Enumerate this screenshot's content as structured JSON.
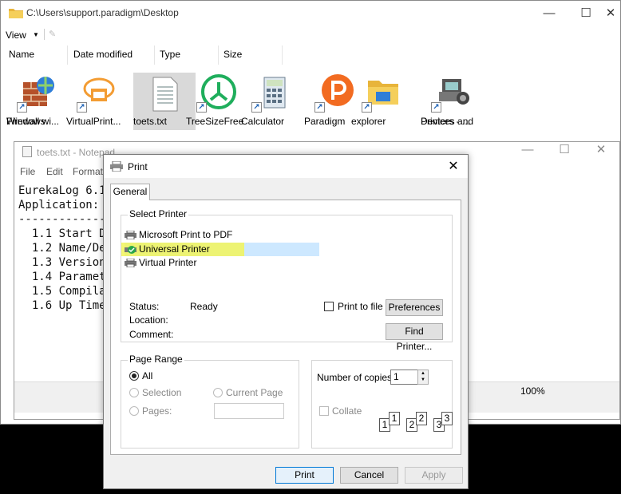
{
  "explorer": {
    "title": "C:\\Users\\support.paradigm\\Desktop",
    "toolbar": {
      "view_label": "View"
    },
    "columns": [
      "Name",
      "Date modified",
      "Type",
      "Size"
    ],
    "items": [
      {
        "label1": "Windows",
        "label2": "Firewall wi...",
        "icon": "firewall-icon"
      },
      {
        "label1": "VirtualPrint...",
        "label2": "",
        "icon": "virtualprinter-icon"
      },
      {
        "label1": "toets.txt",
        "label2": "",
        "icon": "text-file-icon"
      },
      {
        "label1": "TreeSizeFree",
        "label2": "",
        "icon": "treesize-icon"
      },
      {
        "label1": "Calculator",
        "label2": "",
        "icon": "calculator-icon"
      },
      {
        "label1": "Paradigm",
        "label2": "",
        "icon": "paradigm-icon"
      },
      {
        "label1": "explorer",
        "label2": "",
        "icon": "folder-icon"
      },
      {
        "label1": "Devices and",
        "label2": "Printers - ...",
        "icon": "devices-printers-icon"
      }
    ]
  },
  "notepad": {
    "title": "toets.txt - Notepad",
    "menu": [
      "File",
      "Edit",
      "Format"
    ],
    "lines": [
      "EurekaLog 6.1",
      "",
      "Application:",
      "--------------",
      "  1.1 Start Da",
      "  1.2 Name/Des",
      "  1.3 Version",
      "  1.4 Paramete",
      "  1.5 Compilat",
      "  1.6 Up Time"
    ],
    "zoom": "100%"
  },
  "dialog": {
    "title": "Print",
    "tab": "General",
    "select_printer": {
      "label": "Select Printer",
      "printers": [
        "Microsoft Print to PDF",
        "Universal Printer",
        "Virtual Printer"
      ],
      "selected": "Universal Printer"
    },
    "status": {
      "label": "Status:",
      "value": "Ready"
    },
    "location": {
      "label": "Location:",
      "value": ""
    },
    "comment": {
      "label": "Comment:",
      "value": ""
    },
    "print_to_file": "Print to file",
    "preferences": "Preferences",
    "find_printer": "Find Printer...",
    "page_range": {
      "label": "Page Range",
      "all": "All",
      "selection": "Selection",
      "current_page": "Current Page",
      "pages": "Pages:"
    },
    "copies": {
      "label": "Number of copies:",
      "value": "1",
      "collate": "Collate"
    },
    "collate_numbers": [
      "1",
      "1",
      "2",
      "2",
      "3",
      "3"
    ],
    "buttons": {
      "print": "Print",
      "cancel": "Cancel",
      "apply": "Apply"
    }
  },
  "colors": {
    "highlight_yellow": "#f2f55a",
    "selection_blue": "#cde8ff",
    "default_button": "#0078d7"
  }
}
